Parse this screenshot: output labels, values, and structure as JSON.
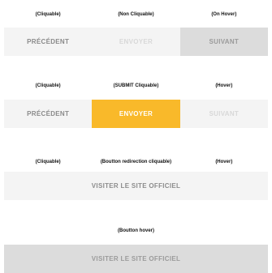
{
  "row1": {
    "captions": [
      "(Cliquable)",
      "(Non Cliquable)",
      "(On Hover)"
    ],
    "buttons": [
      "PRÉCÉDENT",
      "ENVOYER",
      "SUIVANT"
    ]
  },
  "row2": {
    "captions": [
      "(Cliquable)",
      "(SUBMIT Cliquable)",
      "(Hover)"
    ],
    "buttons": [
      "PRÉCÉDENT",
      "ENVOYER",
      "SUIVANT"
    ]
  },
  "row3": {
    "captions": [
      "(Cliquable)",
      "(Boutton redirection cliquable)",
      "(Hover)"
    ],
    "button": "VISITER LE SITE OFFICIEL"
  },
  "row4": {
    "caption": "(Boutton hover)",
    "button": "VISITER LE SITE OFFICIEL"
  },
  "colors": {
    "accent": "#f9b92a",
    "button_bg": "#f4f4f4",
    "button_hover_bg": "#dcdcdc"
  }
}
